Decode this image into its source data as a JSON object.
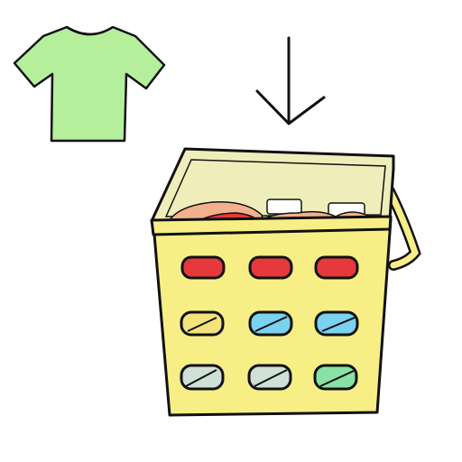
{
  "scene": {
    "background": "#ffffff",
    "items": [
      {
        "name": "t-shirt",
        "icon": "t-shirt-icon",
        "color": "#b5ef9c"
      },
      {
        "name": "down-arrow",
        "icon": "arrow-down-icon"
      },
      {
        "name": "laundry-basket",
        "icon": "laundry-basket-icon",
        "color": "#f7ef86"
      }
    ],
    "basket": {
      "body_color": "#f7ef86",
      "rim_color": "#efeebb",
      "outline_color": "#111111",
      "clothes_color": "#f3b08e",
      "clothes_accent": "#e5393b",
      "holes": [
        [
          "#e5393b",
          "#e5393b",
          "#e5393b"
        ],
        [
          "#f4e37c",
          "#79d2ef",
          "#79d2ef"
        ],
        [
          "#cfe0d6",
          "#cfe0d6",
          "#88e2a5"
        ]
      ]
    }
  }
}
